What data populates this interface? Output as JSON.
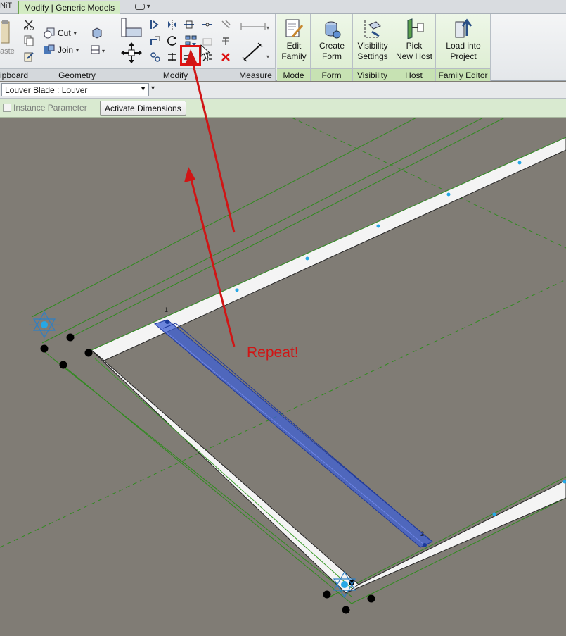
{
  "tabs": {
    "left_partial": "NiT",
    "active": "Modify | Generic Models"
  },
  "ribbon": {
    "clipboard": {
      "title": "ipboard",
      "paste_label": "aste"
    },
    "geometry": {
      "title": "Geometry",
      "cut_label": "Cut",
      "join_label": "Join"
    },
    "modify": {
      "title": "Modify"
    },
    "measure": {
      "title": "Measure"
    },
    "mode": {
      "title": "Mode",
      "edit_family_label": "Edit\nFamily"
    },
    "form": {
      "title": "Form",
      "create_form_label": "Create\nForm"
    },
    "visibility": {
      "title": "Visibility",
      "visibility_settings_label": "Visibility\nSettings"
    },
    "host": {
      "title": "Host",
      "pick_new_host_label": "Pick\nNew Host"
    },
    "family_editor": {
      "title": "Family Editor",
      "load_into_project_label": "Load into\nProject"
    }
  },
  "type_selector": {
    "value": "Louver Blade : Louver"
  },
  "options_bar": {
    "instance_parameter_label": "Instance Parameter",
    "instance_parameter_checked": false,
    "activate_dimensions_label": "Activate Dimensions"
  },
  "canvas": {
    "annotation": "Repeat!",
    "point_label_1": "1",
    "point_label_2": "2"
  },
  "colors": {
    "ribbon_green": "#d3ebc3",
    "annotation_red": "#d01515",
    "selection_blue": "#3355cc",
    "reference_green": "#2f8a1e",
    "canvas_bg": "#807c75"
  }
}
